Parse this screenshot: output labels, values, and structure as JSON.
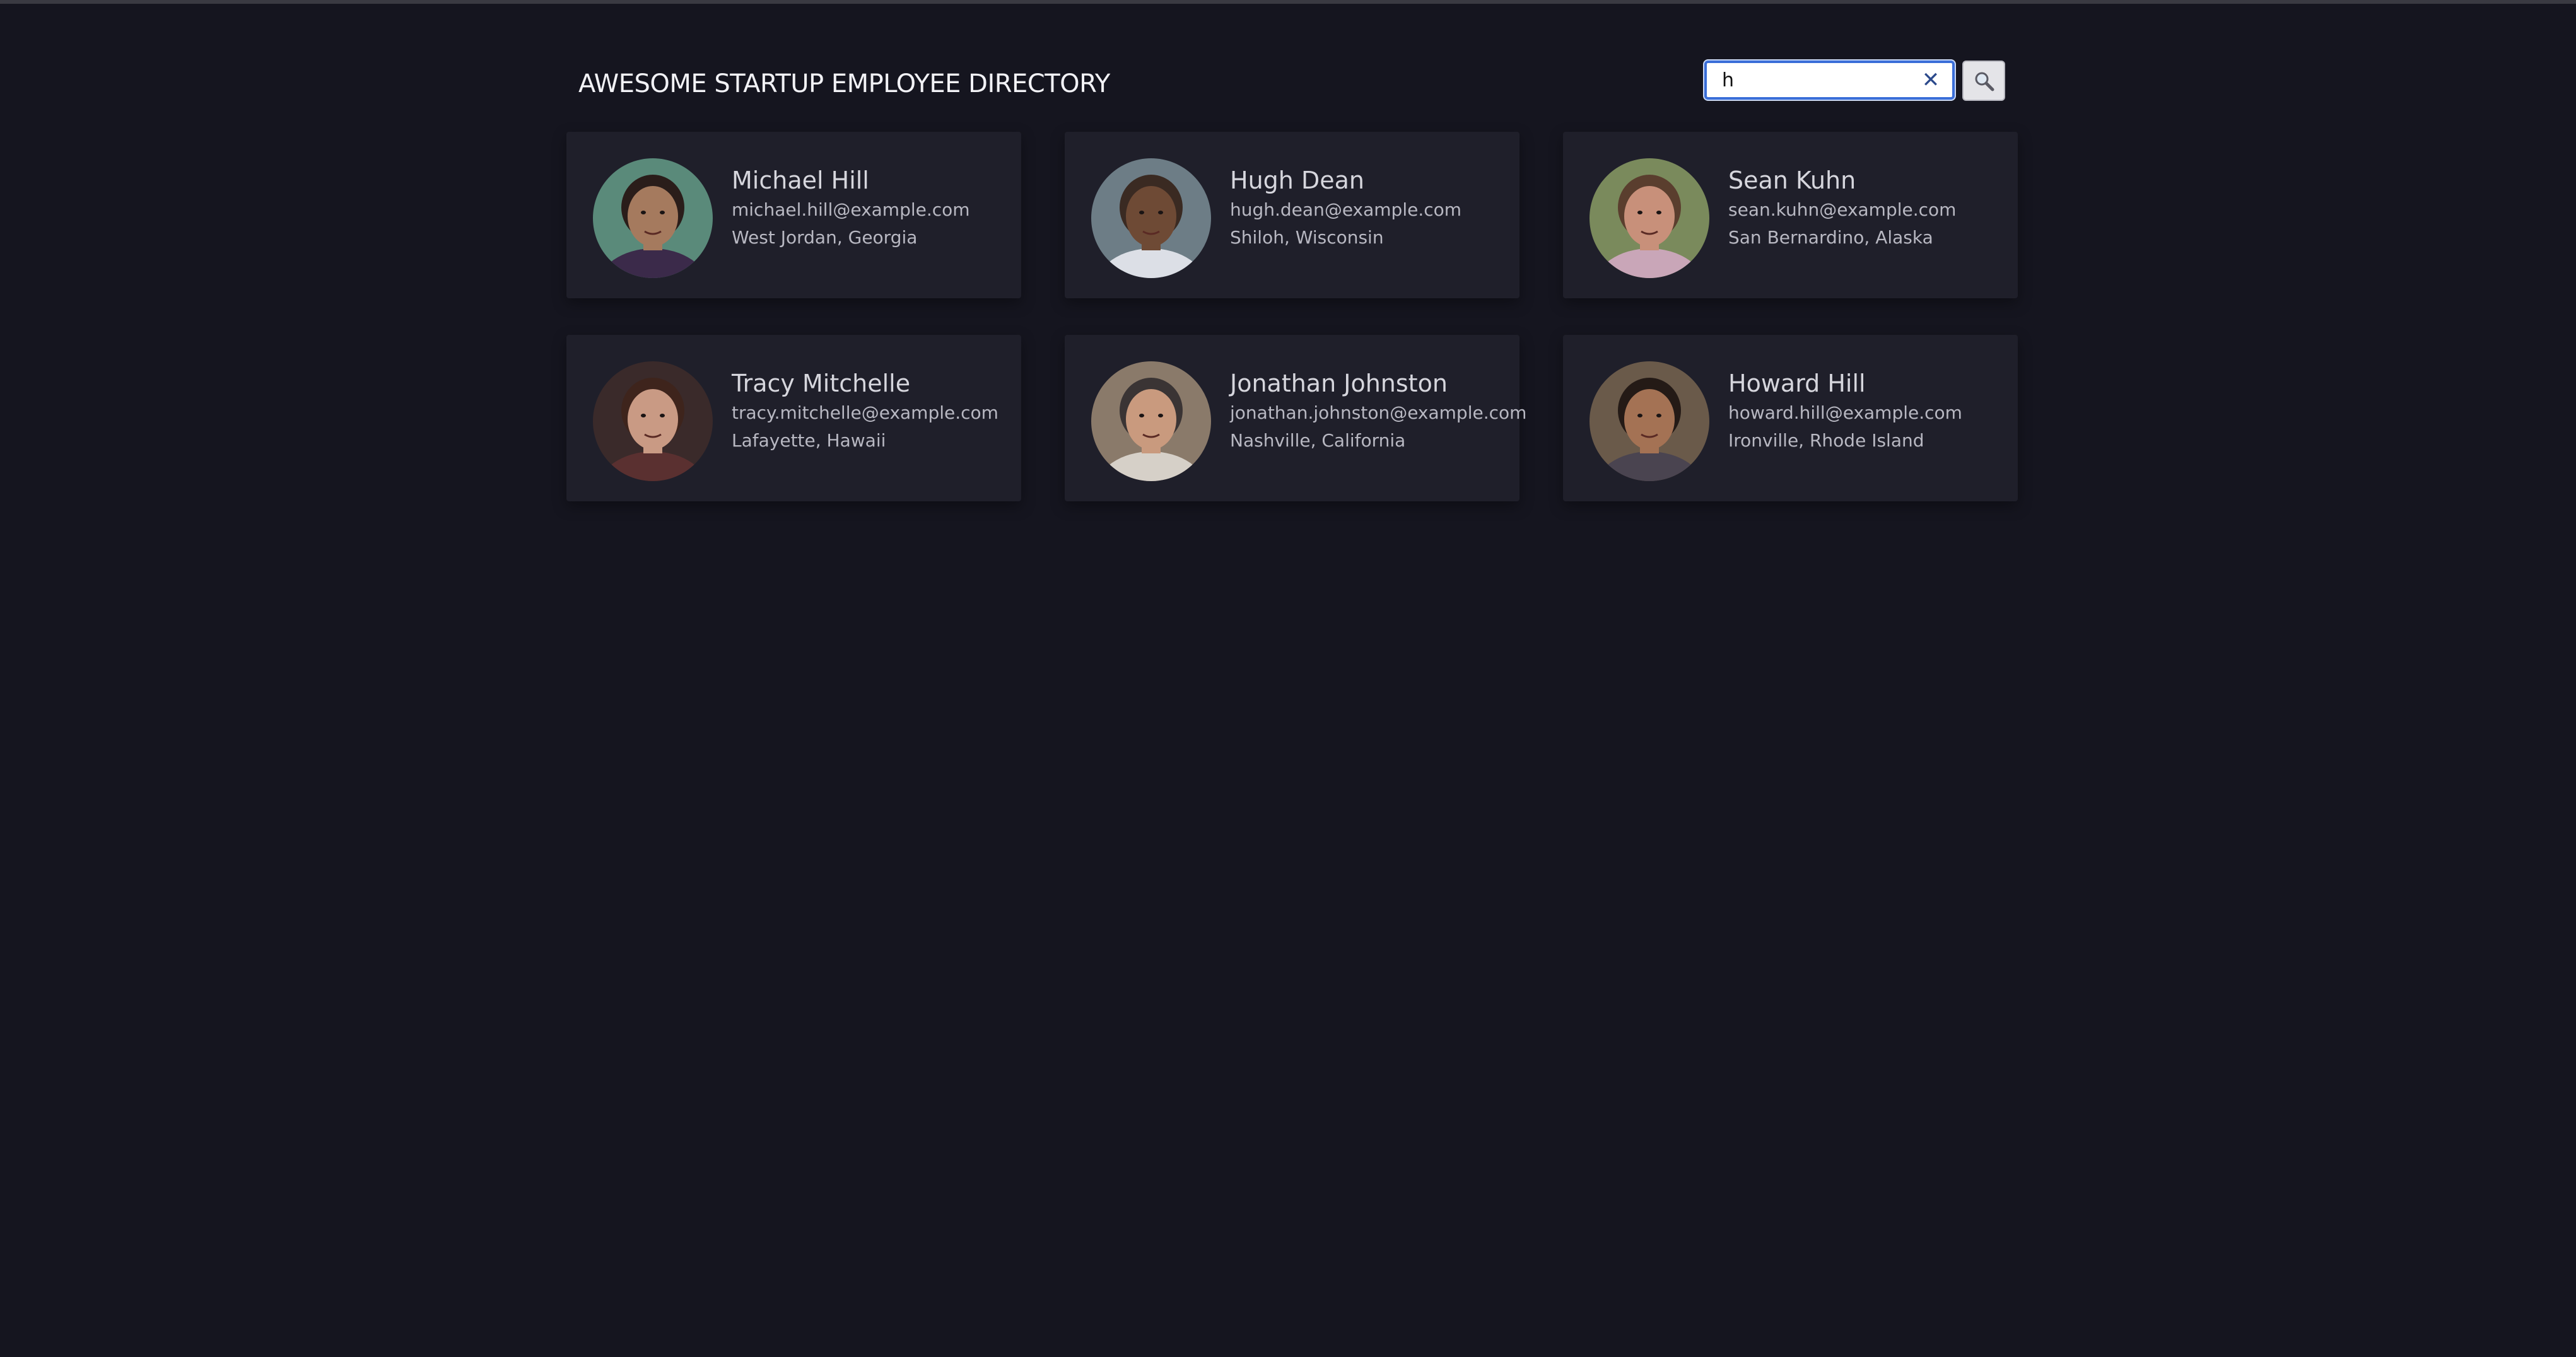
{
  "header": {
    "title": "AWESOME STARTUP EMPLOYEE DIRECTORY"
  },
  "search": {
    "value": "h",
    "clear_icon": "close-icon",
    "button_icon": "search-icon"
  },
  "employees": [
    {
      "name": "Michael Hill",
      "email": "michael.hill@example.com",
      "location": "West Jordan, Georgia",
      "avatar_colors": {
        "bg": "#5a8a7a",
        "skin": "#a57a5e",
        "hair": "#2a1d1a",
        "shirt": "#3b2a4a"
      }
    },
    {
      "name": "Hugh Dean",
      "email": "hugh.dean@example.com",
      "location": "Shiloh, Wisconsin",
      "avatar_colors": {
        "bg": "#6d7d86",
        "skin": "#6e4a35",
        "hair": "#3a2a22",
        "shirt": "#dcdfe6"
      }
    },
    {
      "name": "Sean Kuhn",
      "email": "sean.kuhn@example.com",
      "location": "San Bernardino, Alaska",
      "avatar_colors": {
        "bg": "#7a8a5c",
        "skin": "#c8907a",
        "hair": "#5a3e2e",
        "shirt": "#c9a6b8"
      }
    },
    {
      "name": "Tracy Mitchelle",
      "email": "tracy.mitchelle@example.com",
      "location": "Lafayette, Hawaii",
      "avatar_colors": {
        "bg": "#3a2a2a",
        "skin": "#c99a84",
        "hair": "#3e241c",
        "shirt": "#5a3030"
      }
    },
    {
      "name": "Jonathan Johnston",
      "email": "jonathan.johnston@example.com",
      "location": "Nashville, California",
      "avatar_colors": {
        "bg": "#8a7a6a",
        "skin": "#c99a7e",
        "hair": "#3a3434",
        "shirt": "#d6d0c8"
      }
    },
    {
      "name": "Howard Hill",
      "email": "howard.hill@example.com",
      "location": "Ironville, Rhode Island",
      "avatar_colors": {
        "bg": "#6a5a4a",
        "skin": "#a47254",
        "hair": "#241a16",
        "shirt": "#4a4450"
      }
    }
  ]
}
